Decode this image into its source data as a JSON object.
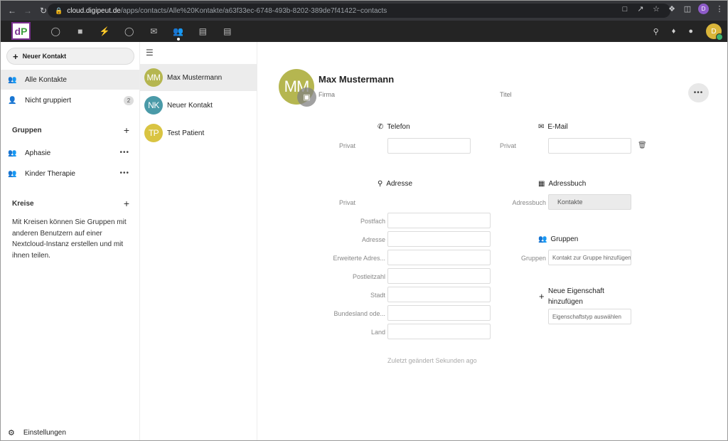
{
  "browser": {
    "back_icon": "arrow-left-icon",
    "url_host": "cloud.digipeut.de",
    "url_path": "/apps/contacts/Alle%20Kontakte/a63f33ec-6748-493b-8202-389de7f41422~contacts",
    "profile_initial": "D"
  },
  "app": {
    "user_initial": "D",
    "logo_letters": [
      "d",
      "P"
    ]
  },
  "nav": {
    "new_contact": "Neuer Kontakt",
    "all_contacts": "Alle Kontakte",
    "ungrouped": "Nicht gruppiert",
    "ungrouped_count": "2",
    "groups_header": "Gruppen",
    "groups": [
      {
        "label": "Aphasie"
      },
      {
        "label": "Kinder Therapie"
      }
    ],
    "circles_header": "Kreise",
    "circles_text": "Mit Kreisen können Sie Gruppen mit anderen Benutzern auf einer Nextcloud-Instanz erstellen und mit ihnen teilen.",
    "settings": "Einstellungen"
  },
  "contacts": [
    {
      "initials": "MM",
      "name": "Max Mustermann",
      "color": "#b5b650"
    },
    {
      "initials": "NK",
      "name": "Neuer Kontakt",
      "color": "#4a9aa8"
    },
    {
      "initials": "TP",
      "name": "Test Patient",
      "color": "#d9c442"
    }
  ],
  "detail": {
    "initials": "MM",
    "name": "Max Mustermann",
    "firma_placeholder": "Firma",
    "titel_placeholder": "Titel",
    "telefon_header": "Telefon",
    "telefon_label": "Privat",
    "email_header": "E-Mail",
    "email_label": "Privat",
    "adresse_header": "Adresse",
    "adresse_label": "Privat",
    "address_fields": [
      "Postfach",
      "Adresse",
      "Erweiterte Adres...",
      "Postleitzahl",
      "Stadt",
      "Bundesland ode...",
      "Land"
    ],
    "addressbook_header": "Adressbuch",
    "addressbook_label": "Adressbuch",
    "addressbook_value": "Kontakte",
    "groups_header": "Gruppen",
    "groups_label": "Gruppen",
    "groups_placeholder": "Kontakt zur Gruppe hinzufügen",
    "new_property": "Neue Eigenschaft hinzufügen",
    "property_placeholder": "Eigenschaftstyp auswählen",
    "last_modified": "Zuletzt geändert Sekunden ago"
  }
}
